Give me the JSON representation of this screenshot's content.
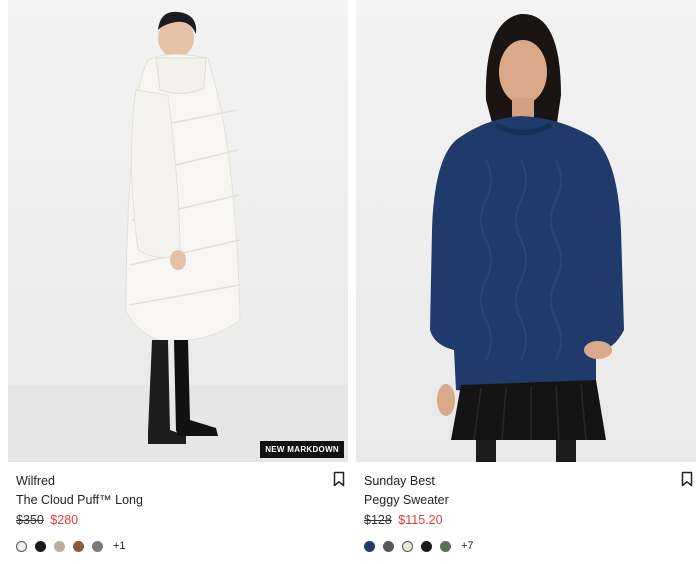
{
  "products": [
    {
      "brand": "Wilfred",
      "name": "The Cloud Puff™ Long",
      "original_price": "$350",
      "sale_price": "$280",
      "badge": "NEW MARKDOWN",
      "swatches": [
        "#f2f0ea",
        "#1b1b1b",
        "#b7ae9c",
        "#8b5a3c",
        "#7b7b7b"
      ],
      "more_colors": "+1"
    },
    {
      "brand": "Sunday Best",
      "name": "Peggy Sweater",
      "original_price": "$128",
      "sale_price": "$115.20",
      "swatches": [
        "#243a66",
        "#58595b",
        "#ebe8dc",
        "#1b1b1b",
        "#5a6e58"
      ],
      "more_colors": "+7"
    }
  ],
  "colors": {
    "sale": "#e03a3a",
    "badge_bg": "#111111"
  }
}
